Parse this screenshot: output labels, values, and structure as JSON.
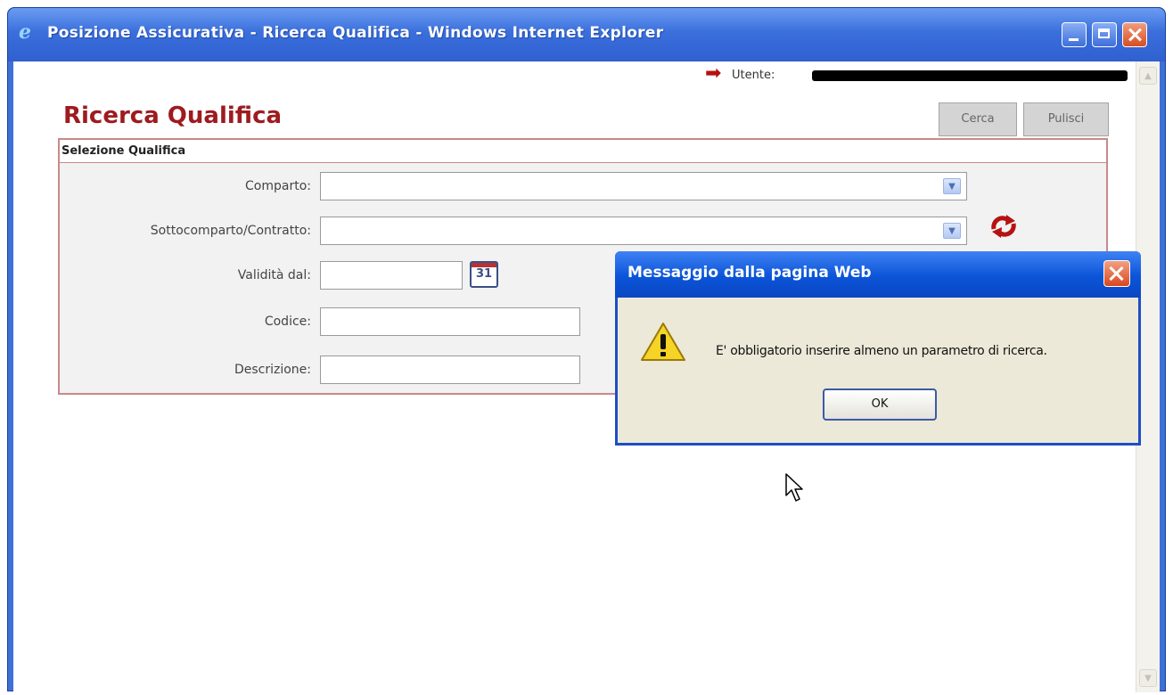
{
  "window": {
    "title": "Posizione Assicurativa - Ricerca Qualifica - Windows Internet Explorer",
    "icon": "ie-logo-icon"
  },
  "header": {
    "user_label": "Utente:"
  },
  "page": {
    "title": "Ricerca Qualifica",
    "search_button": "Cerca",
    "clear_button": "Pulisci"
  },
  "panel": {
    "title": "Selezione Qualifica",
    "fields": {
      "comparto_label": "Comparto:",
      "sottocomparto_label": "Sottocomparto/Contratto:",
      "validita_label": "Validità dal:",
      "codice_label": "Codice:",
      "descrizione_label": "Descrizione:",
      "calendar_day": "31"
    }
  },
  "dialog": {
    "title": "Messaggio dalla pagina Web",
    "message": "E' obbligatorio inserire almeno un parametro di ricerca.",
    "ok_button": "OK"
  },
  "colors": {
    "page_title": "#9e1b20",
    "panel_border": "#c9898b",
    "dialog_title_bar": "#0b54d8",
    "window_title_bar": "#3a6fdc"
  }
}
